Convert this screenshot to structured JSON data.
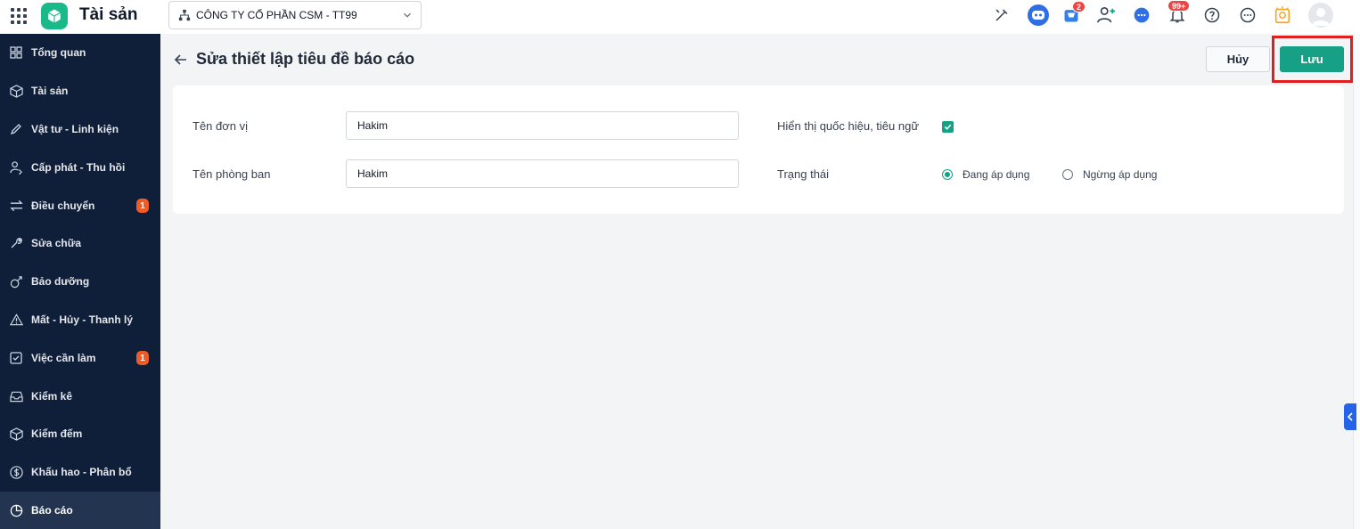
{
  "app": {
    "title": "Tài sản",
    "brand_color": "#19b98a"
  },
  "company_select": {
    "value": "CÔNG TY CỔ PHẦN CSM - TT99"
  },
  "topbar": {
    "icons": [
      "tools-icon",
      "bot-icon",
      "cart-icon",
      "add-user-icon",
      "chat-icon",
      "bell-icon",
      "help-icon",
      "more-icon",
      "lightbulb-icon",
      "avatar"
    ],
    "cart_badge": "2",
    "bell_badge": "99+"
  },
  "sidebar": {
    "items": [
      {
        "label": "Tổng quan",
        "icon": "dashboard-icon"
      },
      {
        "label": "Tài sản",
        "icon": "box-icon"
      },
      {
        "label": "Vật tư - Linh kiện",
        "icon": "pen-icon"
      },
      {
        "label": "Cấp phát - Thu hồi",
        "icon": "user-transfer-icon"
      },
      {
        "label": "Điều chuyển",
        "icon": "swap-icon",
        "badge": "1"
      },
      {
        "label": "Sửa chữa",
        "icon": "wrench-icon"
      },
      {
        "label": "Bảo dưỡng",
        "icon": "maintenance-icon"
      },
      {
        "label": "Mất - Hủy - Thanh lý",
        "icon": "warning-icon"
      },
      {
        "label": "Việc cần làm",
        "icon": "checkbox-icon",
        "badge": "1"
      },
      {
        "label": "Kiểm kê",
        "icon": "inbox-icon"
      },
      {
        "label": "Kiểm đếm",
        "icon": "box-count-icon"
      },
      {
        "label": "Khấu hao - Phân bổ",
        "icon": "dollar-icon"
      },
      {
        "label": "Báo cáo",
        "icon": "pie-chart-icon",
        "active": true
      }
    ]
  },
  "page": {
    "title": "Sửa thiết lập tiêu đề báo cáo",
    "cancel_label": "Hủy",
    "save_label": "Lưu"
  },
  "form": {
    "unit_name_label": "Tên đơn vị",
    "unit_name_value": "Hakim",
    "department_label": "Tên phòng ban",
    "department_value": "Hakim",
    "show_motto_label": "Hiển thị quốc hiệu, tiêu ngữ",
    "show_motto_checked": true,
    "status_label": "Trạng thái",
    "status_options": [
      {
        "label": "Đang áp dụng",
        "selected": true
      },
      {
        "label": "Ngừng áp dụng",
        "selected": false
      }
    ]
  }
}
